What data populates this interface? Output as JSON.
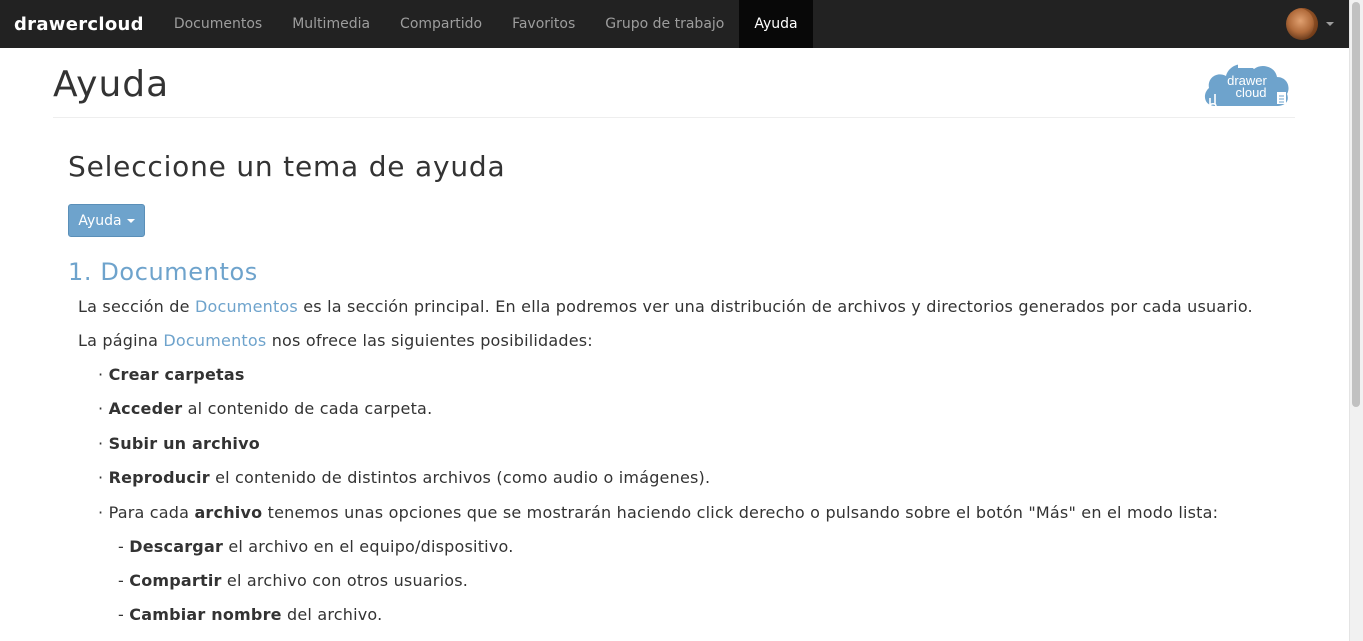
{
  "navbar": {
    "brand": "drawercloud",
    "items": [
      {
        "label": "Documentos"
      },
      {
        "label": "Multimedia"
      },
      {
        "label": "Compartido"
      },
      {
        "label": "Favoritos"
      },
      {
        "label": "Grupo de trabajo"
      },
      {
        "label": "Ayuda"
      }
    ],
    "active_index": 5,
    "user_menu": {
      "avatar_icon": "user-avatar",
      "caret_icon": "caret-down-icon"
    }
  },
  "header": {
    "title": "Ayuda",
    "logo_text_line1": "drawer",
    "logo_text_line2": "cloud"
  },
  "main": {
    "heading": "Seleccione un tema de ayuda",
    "help_button_label": "Ayuda",
    "topic_title": "1. Documentos",
    "p1": {
      "pre": "La sección de ",
      "link": "Documentos",
      "post": " es la sección principal. En ella podremos ver una distribución de archivos y directorios generados por cada usuario."
    },
    "p2": {
      "pre": "La página ",
      "link": "Documentos",
      "post": " nos ofrece las siguientes posibilidades:"
    },
    "bullets": [
      {
        "prefix": "· ",
        "bold": "Crear carpetas",
        "rest": ""
      },
      {
        "prefix": "· ",
        "bold": "Acceder",
        "rest": " al contenido de cada carpeta."
      },
      {
        "prefix": "· ",
        "bold": "Subir un archivo",
        "rest": ""
      },
      {
        "prefix": "· ",
        "bold": "Reproducir",
        "rest": " el contenido de distintos archivos (como audio o imágenes)."
      },
      {
        "prefix": "· Para cada ",
        "bold": "archivo",
        "rest": " tenemos unas opciones que se mostrarán haciendo click derecho o pulsando sobre el botón \"Más\" en el modo lista:"
      }
    ],
    "sub_bullets": [
      {
        "prefix": "- ",
        "bold": "Descargar",
        "rest": " el archivo en el equipo/dispositivo."
      },
      {
        "prefix": "- ",
        "bold": "Compartir",
        "rest": " el archivo con otros usuarios."
      },
      {
        "prefix": "- ",
        "bold": "Cambiar nombre",
        "rest": " del archivo."
      }
    ]
  },
  "colors": {
    "navbar_bg": "#222222",
    "nav_active_bg": "#080808",
    "accent": "#6ea3cc",
    "text": "#333333"
  }
}
